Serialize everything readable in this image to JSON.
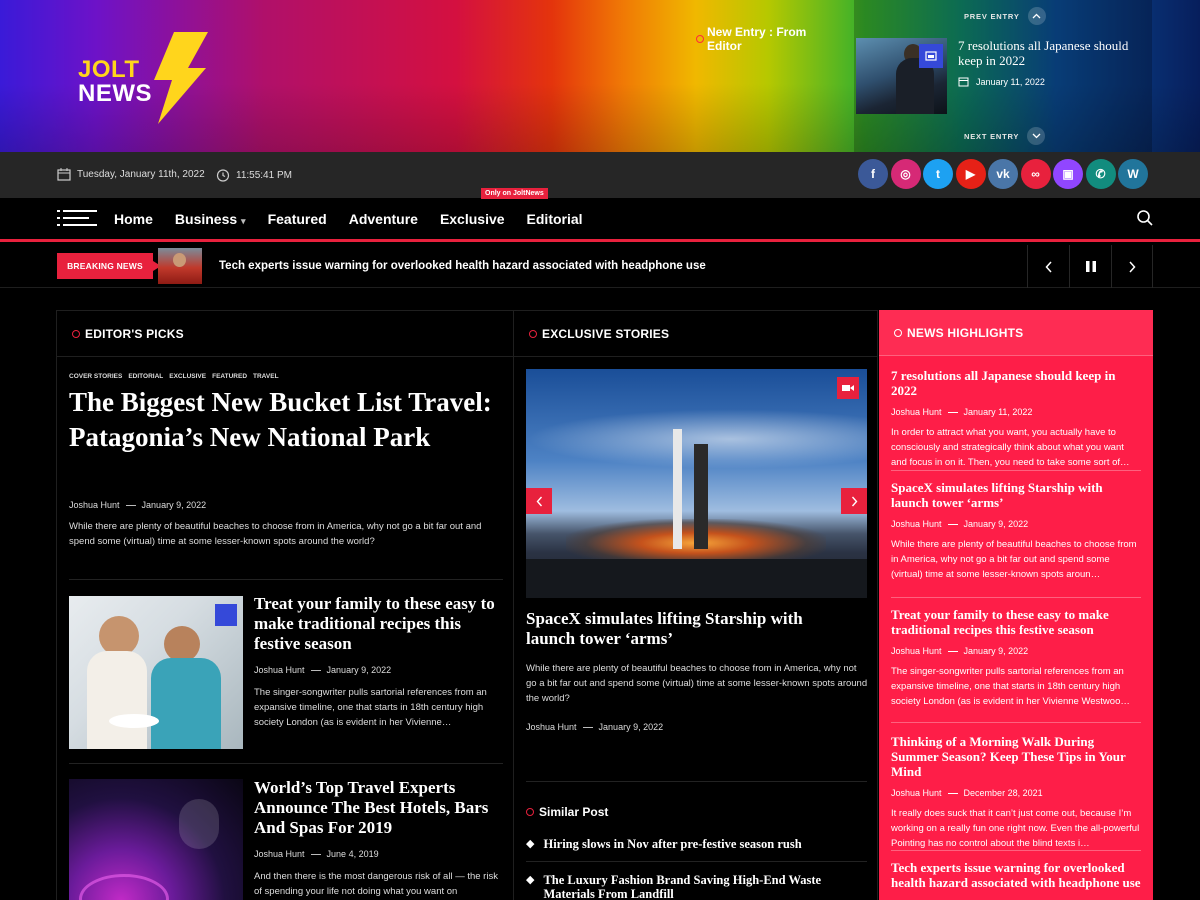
{
  "logo": {
    "line1": "JOLT",
    "line2": "NEWS"
  },
  "header": {
    "new_entry_label": "New Entry : From Editor",
    "prev_label": "PREV ENTRY",
    "next_label": "NEXT ENTRY",
    "featured_entry": {
      "title": "7 resolutions all Japanese should keep in 2022",
      "date": "January 11, 2022"
    }
  },
  "infobar": {
    "date": "Tuesday, January 11th, 2022",
    "time": "11:55:41 PM"
  },
  "socials": [
    {
      "icon": "facebook-icon",
      "glyph": "f",
      "color": "#3b5998"
    },
    {
      "icon": "instagram-icon",
      "glyph": "◎",
      "color": "#d62976"
    },
    {
      "icon": "twitter-icon",
      "glyph": "t",
      "color": "#1da1f2"
    },
    {
      "icon": "youtube-icon",
      "glyph": "▶",
      "color": "#e62117"
    },
    {
      "icon": "vk-icon",
      "glyph": "vk",
      "color": "#4a76a8"
    },
    {
      "icon": "link-icon",
      "glyph": "∞",
      "color": "#e8213d"
    },
    {
      "icon": "twitch-icon",
      "glyph": "▣",
      "color": "#9146ff"
    },
    {
      "icon": "whatsapp-icon",
      "glyph": "✆",
      "color": "#128c7e"
    },
    {
      "icon": "wordpress-icon",
      "glyph": "W",
      "color": "#21759b"
    }
  ],
  "nav": {
    "items": [
      "Home",
      "Business",
      "Featured",
      "Adventure",
      "Exclusive",
      "Editorial"
    ],
    "business_dropdown": "▾",
    "badge": "Only on JoltNews"
  },
  "breaking": {
    "label": "BREAKING NEWS",
    "headline": "Tech experts issue warning for overlooked health hazard associated with headphone use"
  },
  "editors_picks": {
    "heading": "EDITOR'S PICKS",
    "tags": [
      "COVER STORIES",
      "EDITORIAL",
      "EXCLUSIVE",
      "FEATURED",
      "TRAVEL"
    ],
    "main": {
      "title": "The Biggest New Bucket List Travel: Patagonia’s New National Park",
      "author": "Joshua Hunt",
      "date": "January 9, 2022",
      "excerpt": "While there are plenty of beautiful beaches to choose from in America, why not go a bit far out and spend some (virtual) time at some lesser-known spots around the world?"
    },
    "cards": [
      {
        "title": "Treat your family to these easy to make traditional recipes this festive season",
        "author": "Joshua Hunt",
        "date": "January 9, 2022",
        "excerpt": "The singer-songwriter pulls sartorial references from an expansive timeline, one that starts in 18th century high society London (as is evident in her Vivienne…"
      },
      {
        "title": "World’s Top Travel Experts Announce The Best Hotels, Bars And Spas For 2019",
        "author": "Joshua Hunt",
        "date": "June 4, 2019",
        "excerpt": "And then there is the most dangerous risk of all — the risk of spending your life not doing what you want on"
      }
    ]
  },
  "exclusive": {
    "heading": "EXCLUSIVE STORIES",
    "main": {
      "title": "SpaceX simulates lifting Starship with launch tower ‘arms’",
      "author": "Joshua Hunt",
      "date": "January 9, 2022",
      "excerpt": "While there are plenty of beautiful beaches to choose from in America, why not go a bit far out and spend some (virtual) time at some lesser-known spots around the world?"
    },
    "similar_heading": "Similar Post",
    "similar": [
      "Hiring slows in Nov after pre-festive season rush",
      "The Luxury Fashion Brand Saving High-End Waste Materials From Landfill"
    ]
  },
  "highlights": {
    "heading": "NEWS HIGHLIGHTS",
    "items": [
      {
        "title": "7 resolutions all Japanese should keep in 2022",
        "author": "Joshua Hunt",
        "date": "January 11, 2022",
        "excerpt": "In order to attract what you want, you actually have to consciously and strategically think about what you want and focus in on it. Then, you need to take some sort of…"
      },
      {
        "title": "SpaceX simulates lifting Starship with launch tower ‘arms’",
        "author": "Joshua Hunt",
        "date": "January 9, 2022",
        "excerpt": "While there are plenty of beautiful beaches to choose from in America, why not go a bit far out and spend some (virtual) time at some lesser-known spots aroun…"
      },
      {
        "title": "Treat your family to these easy to make traditional recipes this festive season",
        "author": "Joshua Hunt",
        "date": "January 9, 2022",
        "excerpt": "The singer-songwriter pulls sartorial references from an expansive timeline, one that starts in 18th century high society London (as is evident in her Vivienne Westwoo…"
      },
      {
        "title": "Thinking of a Morning Walk During Summer Season? Keep These Tips in Your Mind",
        "author": "Joshua Hunt",
        "date": "December 28, 2021",
        "excerpt": "It really does suck that it can’t just come out, because I’m working on a really fun one right now. Even the all-powerful Pointing has no control about the blind texts i…"
      },
      {
        "title": "Tech experts issue warning for overlooked health hazard associated with headphone use"
      }
    ]
  }
}
